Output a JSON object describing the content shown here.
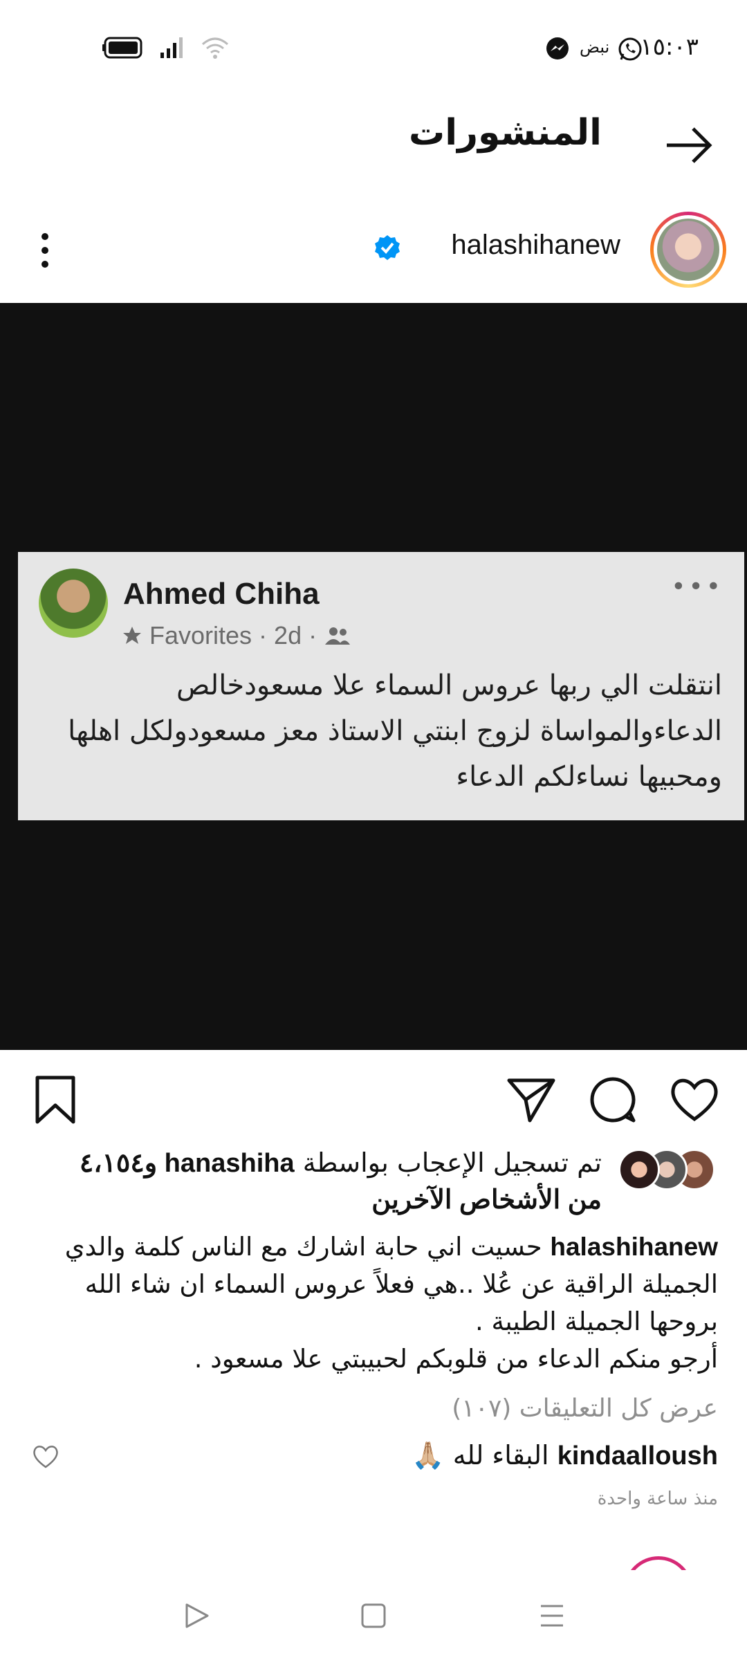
{
  "status_bar": {
    "time": "١٥:٠٣",
    "notif_label": "نبض"
  },
  "header": {
    "title": "المنشورات",
    "back_icon": "arrow-right-icon"
  },
  "post": {
    "username": "halashihanew",
    "verified": true,
    "shared_image": {
      "author": "Ahmed Chiha",
      "meta_favorites": "Favorites",
      "meta_time": "2d",
      "meta_sep": "·",
      "dots": "•••",
      "text": "انتقلت الي ربها عروس السماء علا مسعودخالص الدعاءوالمواساة لزوج ابنتي الاستاذ معز مسعودولكل اهلها ومحبيها نساءلكم الدعاء"
    },
    "likes": {
      "prefix": "تم تسجيل الإعجاب بواسطة ",
      "liker": "hanashiha",
      "suffix": " و٤،١٥٤ من الأشخاص الآخرين"
    },
    "caption": {
      "user": "halashihanew",
      "text": "حسيت اني حابة اشارك مع الناس كلمة والدي الجميلة الراقية عن عُلا ..هي فعلاً عروس السماء ان شاء الله بروحها الجميلة الطيبة .",
      "text2": "أرجو منكم الدعاء من قلوبكم لحبيبتي علا مسعود ."
    },
    "view_comments": "عرض كل التعليقات (١٠٧)",
    "comment": {
      "user": "kindaalloush",
      "text": "البقاء لله 🙏🏼"
    },
    "time_ago": "منذ ساعة واحدة"
  },
  "colors": {
    "verified_blue": "#0095f6",
    "muted": "#8e8e8e",
    "media_bg": "#111111"
  }
}
